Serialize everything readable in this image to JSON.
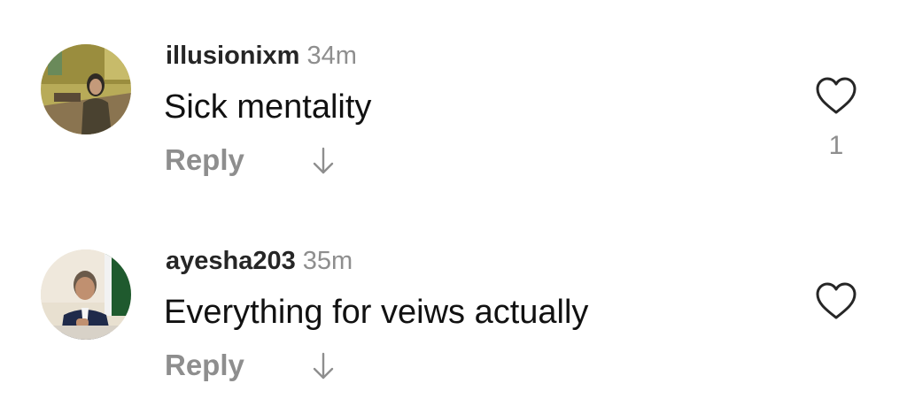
{
  "comments": [
    {
      "username": "illusionixm",
      "time": "34m",
      "text": "Sick mentality",
      "reply_label": "Reply",
      "like_count": "1",
      "avatar_icon": "user-photo-avatar",
      "like_icon": "heart-outline-icon",
      "translate_icon": "arrow-down-icon"
    },
    {
      "username": "ayesha203",
      "time": "35m",
      "text": "Everything for veiws actually",
      "reply_label": "Reply",
      "like_count": "",
      "avatar_icon": "user-photo-avatar",
      "like_icon": "heart-outline-icon",
      "translate_icon": "arrow-down-icon"
    }
  ],
  "colors": {
    "username": "#262626",
    "secondary": "#8e8e8e",
    "text": "#111111",
    "background": "#ffffff"
  }
}
